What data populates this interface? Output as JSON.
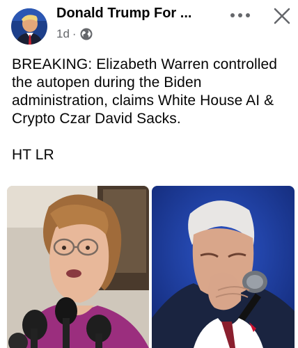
{
  "post": {
    "author": "Donald Trump For ...",
    "time": "1d",
    "separator": "·",
    "visibility_icon": "globe-icon",
    "text_main": "BREAKING: Elizabeth Warren controlled the autopen during the Biden administration, claims White House AI & Crypto Czar David Sacks.",
    "text_ht": "HT LR"
  },
  "actions": {
    "more_icon": "more-options-icon",
    "close_icon": "close-icon"
  },
  "colors": {
    "meta_gray": "#65676b",
    "left_photo_bg": "#cfc7bb",
    "right_photo_bg": "#1e3b9c"
  }
}
